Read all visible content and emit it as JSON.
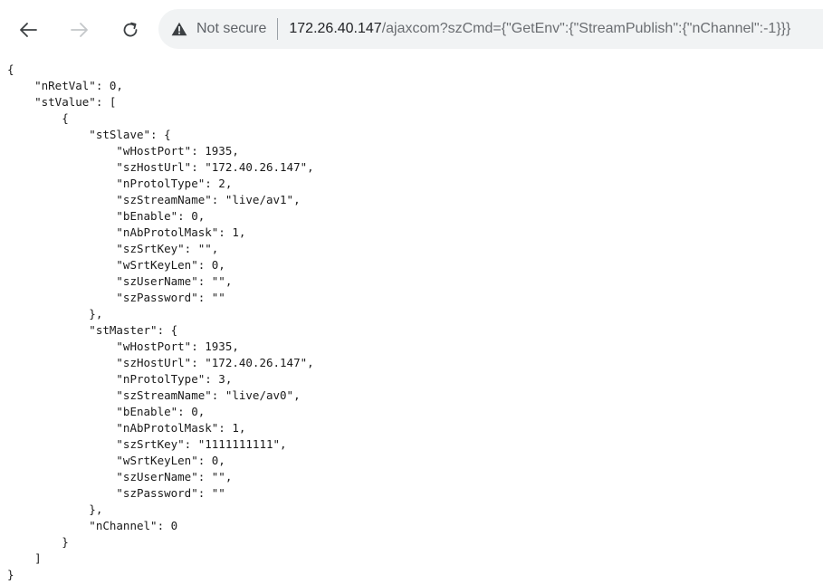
{
  "browser": {
    "security_label": "Not secure",
    "url_host": "172.26.40.147",
    "url_path": "/ajaxcom?szCmd={\"GetEnv\":{\"StreamPublish\":{\"nChannel\":-1}}}",
    "icons": {
      "back": "arrow-left-icon",
      "forward": "arrow-right-icon",
      "reload": "reload-icon",
      "warning": "warning-triangle-icon"
    }
  },
  "json_lines": [
    "{",
    "    \"nRetVal\": 0,",
    "    \"stValue\": [",
    "        {",
    "            \"stSlave\": {",
    "                \"wHostPort\": 1935,",
    "                \"szHostUrl\": \"172.40.26.147\",",
    "                \"nProtolType\": 2,",
    "                \"szStreamName\": \"live/av1\",",
    "                \"bEnable\": 0,",
    "                \"nAbProtolMask\": 1,",
    "                \"szSrtKey\": \"\",",
    "                \"wSrtKeyLen\": 0,",
    "                \"szUserName\": \"\",",
    "                \"szPassword\": \"\"",
    "            },",
    "            \"stMaster\": {",
    "                \"wHostPort\": 1935,",
    "                \"szHostUrl\": \"172.40.26.147\",",
    "                \"nProtolType\": 3,",
    "                \"szStreamName\": \"live/av0\",",
    "                \"bEnable\": 0,",
    "                \"nAbProtolMask\": 1,",
    "                \"szSrtKey\": \"1111111111\",",
    "                \"wSrtKeyLen\": 0,",
    "                \"szUserName\": \"\",",
    "                \"szPassword\": \"\"",
    "            },",
    "            \"nChannel\": 0",
    "        }",
    "    ]",
    "}"
  ]
}
